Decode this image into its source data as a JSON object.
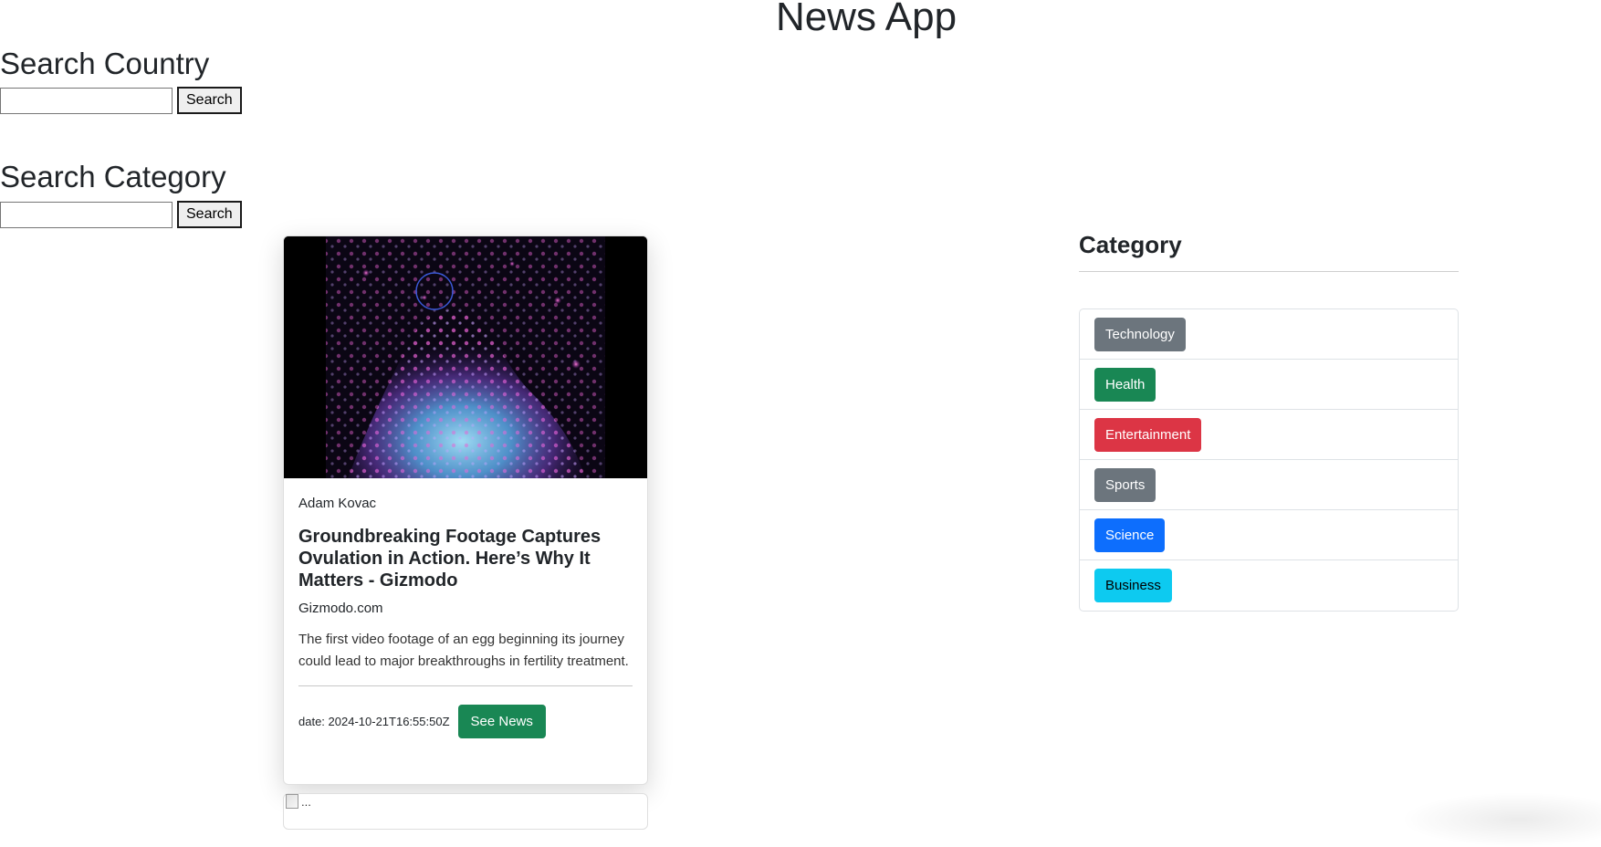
{
  "app": {
    "title": "News App"
  },
  "search_country": {
    "heading": "Search Country",
    "value": "",
    "button_label": "Search"
  },
  "search_category": {
    "heading": "Search Category",
    "value": "",
    "button_label": "Search"
  },
  "article": {
    "author": "Adam Kovac",
    "title": "Groundbreaking Footage Captures Ovulation in Action. Here’s Why It Matters - Gizmodo",
    "source": "Gizmodo.com",
    "description": "The first video footage of an egg beginning its journey could lead to major breakthroughs in fertility treatment.",
    "date": "date: 2024-10-21T16:55:50Z",
    "button_label": "See News"
  },
  "next_article": {
    "image_alt": "..."
  },
  "sidebar": {
    "heading": "Category",
    "categories": [
      {
        "label": "Technology",
        "color": "#6c757d",
        "text_color": "#ffffff"
      },
      {
        "label": "Health",
        "color": "#198754",
        "text_color": "#ffffff"
      },
      {
        "label": "Entertainment",
        "color": "#dc3545",
        "text_color": "#ffffff"
      },
      {
        "label": "Sports",
        "color": "#6c757d",
        "text_color": "#ffffff"
      },
      {
        "label": "Science",
        "color": "#0d6efd",
        "text_color": "#ffffff"
      },
      {
        "label": "Business",
        "color": "#0dcaf0",
        "text_color": "#000000"
      }
    ]
  }
}
